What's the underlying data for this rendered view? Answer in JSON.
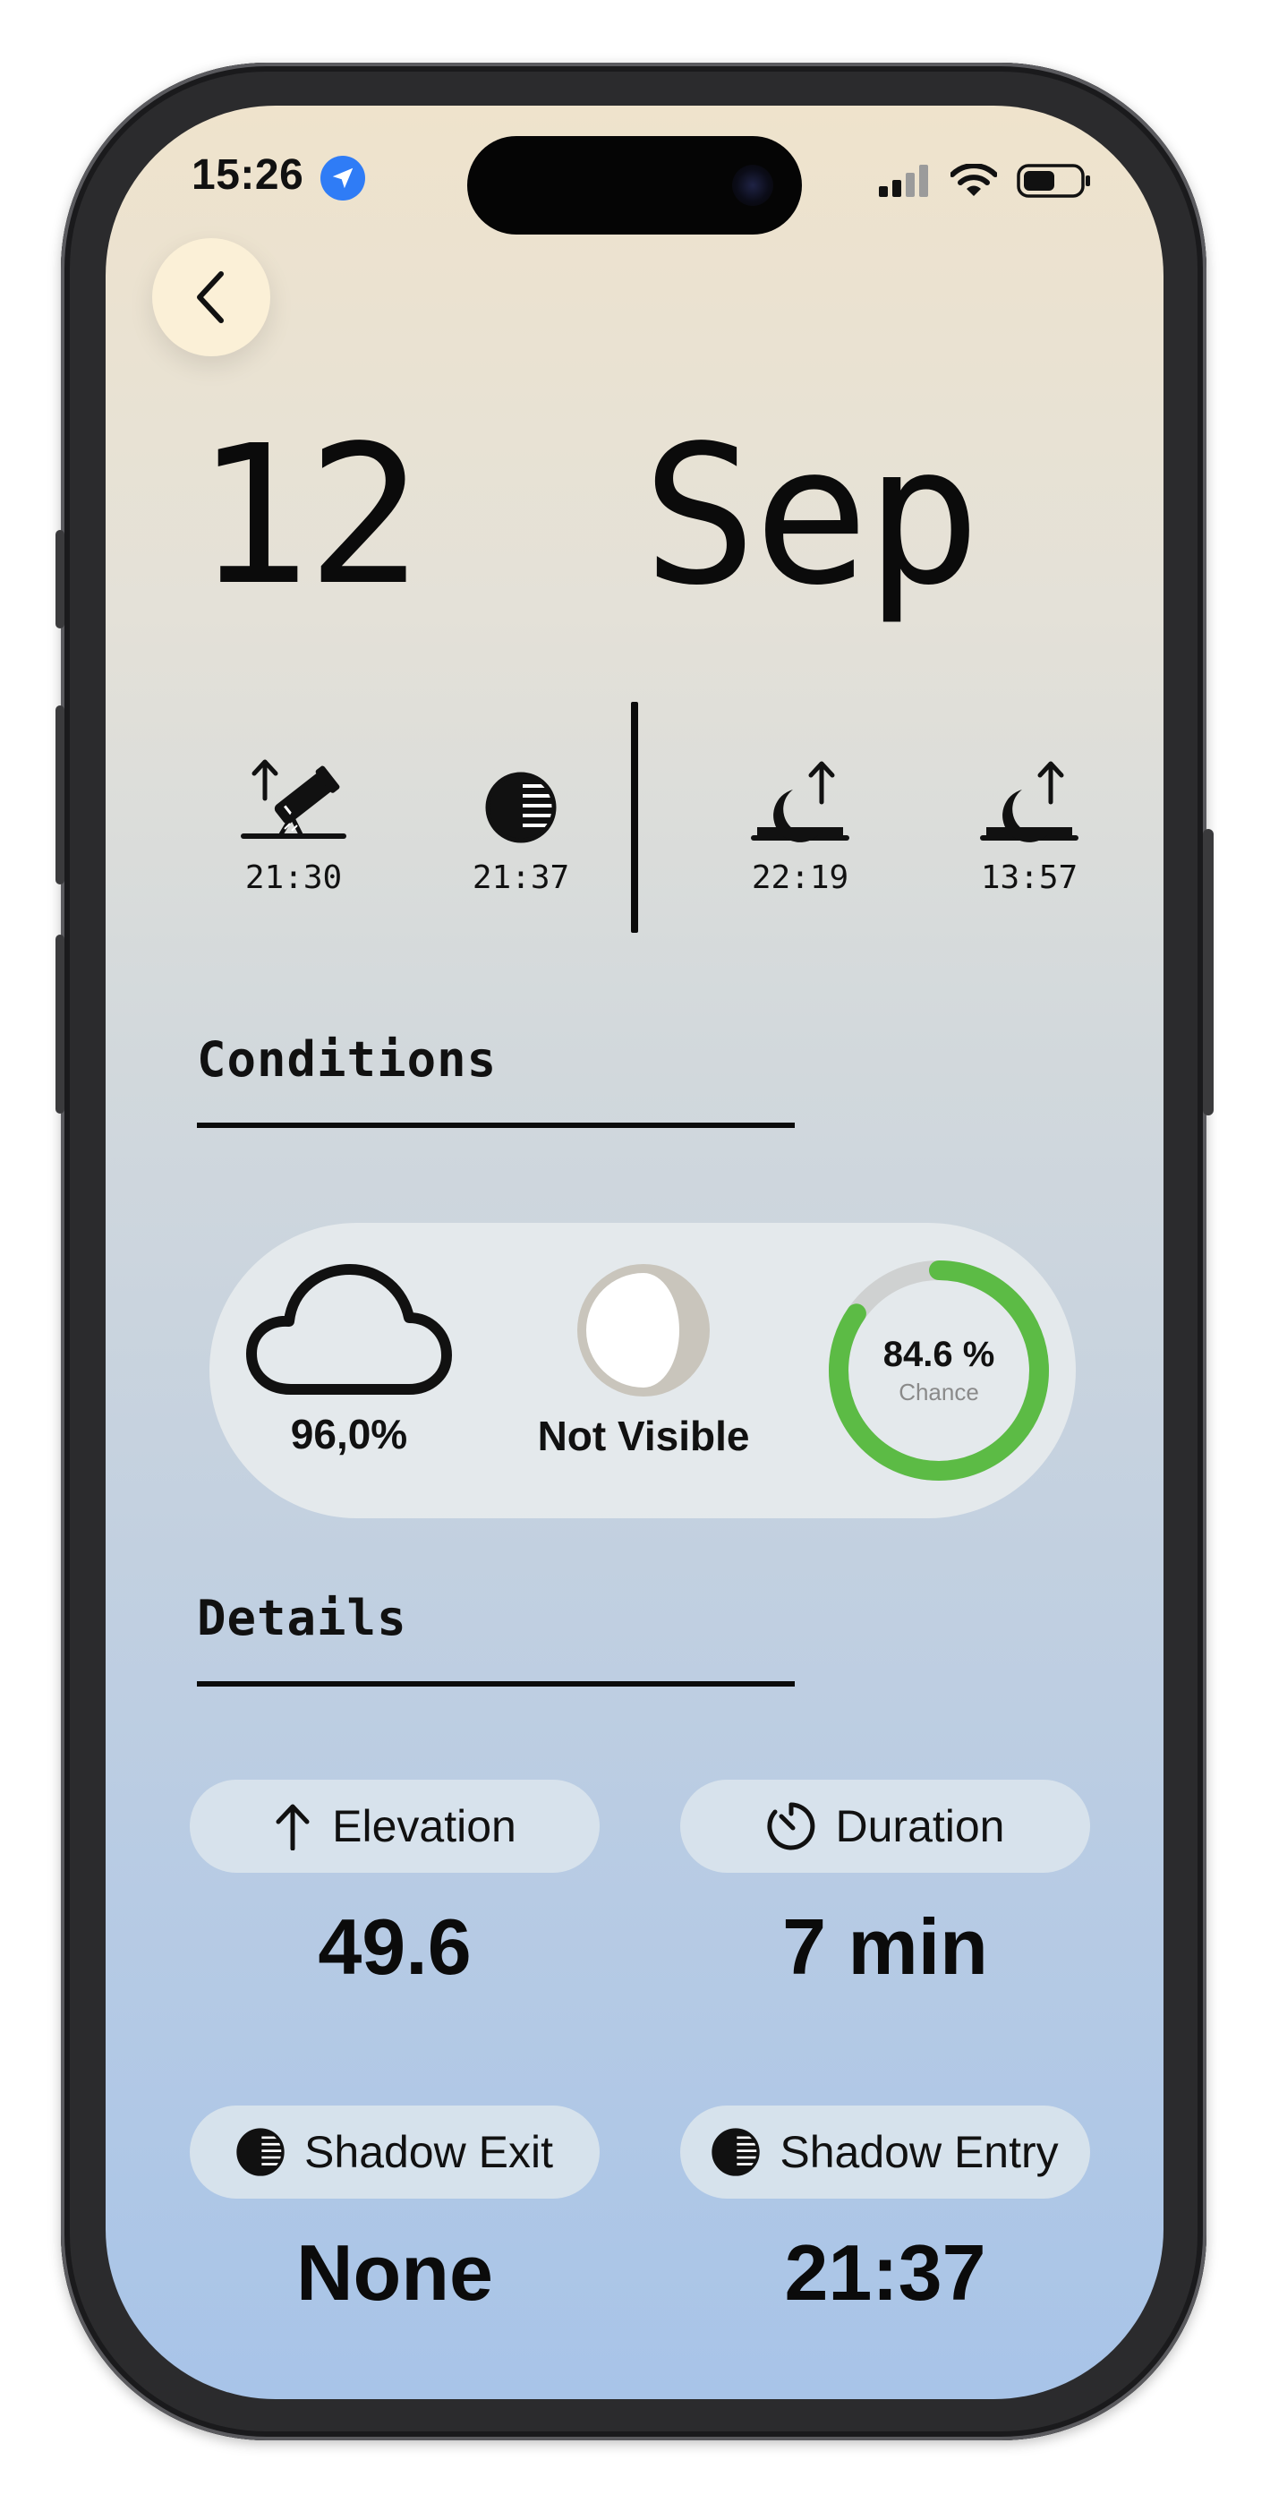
{
  "status_bar": {
    "time": "15:26",
    "icons": [
      "location-arrow-icon",
      "cellular-signal-icon",
      "wifi-icon",
      "battery-icon"
    ],
    "accent_color": "#2f7cf6"
  },
  "header": {
    "back_icon": "chevron-left-icon",
    "date_title": "12  Sep"
  },
  "events": [
    {
      "icon": "telescope-rise-icon",
      "time": "21:30"
    },
    {
      "icon": "half-shadow-icon",
      "time": "21:37"
    },
    {
      "icon": "moonrise-icon",
      "time": "22:19"
    },
    {
      "icon": "moonrise-icon",
      "time": "13:57"
    }
  ],
  "conditions": {
    "title": "Conditions",
    "cloud": {
      "icon": "cloud-icon",
      "value": "96,0%"
    },
    "moon": {
      "icon": "moon-phase-icon",
      "label": "Not Visible"
    },
    "chance": {
      "value_text": "84.6 %",
      "label": "Chance",
      "fraction": 0.846,
      "color": "#5cbb45",
      "track_color": "#cfd1d1"
    }
  },
  "details": {
    "title": "Details",
    "items": [
      {
        "icon": "arrow-up-icon",
        "label": "Elevation",
        "value": "49.6"
      },
      {
        "icon": "timer-icon",
        "label": "Duration",
        "value": "7 min"
      },
      {
        "icon": "half-shadow-icon",
        "label": "Shadow Exit",
        "value": "None"
      },
      {
        "icon": "half-shadow-icon",
        "label": "Shadow Entry",
        "value": "21:37"
      }
    ]
  }
}
